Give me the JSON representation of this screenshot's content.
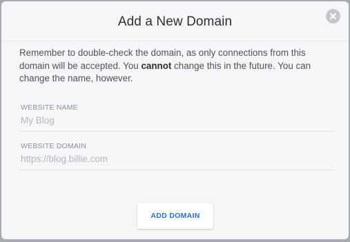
{
  "dialog": {
    "title": "Add a New Domain",
    "message_part1": "Remember to double-check the domain, as only connections from this domain will be accepted. You ",
    "message_bold": "cannot",
    "message_part2": " change this in the future. You can change the name, however.",
    "close_icon": "close-icon"
  },
  "fields": {
    "website_name": {
      "label": "WEBSITE NAME",
      "value": "",
      "placeholder": "My Blog"
    },
    "website_domain": {
      "label": "WEBSITE DOMAIN",
      "value": "",
      "placeholder": "https://blog.billie.com"
    }
  },
  "actions": {
    "add_domain_label": "ADD DOMAIN"
  },
  "colors": {
    "accent": "#1f6fd1",
    "background": "#f5f6f8",
    "overlay": "#a7aab0"
  }
}
